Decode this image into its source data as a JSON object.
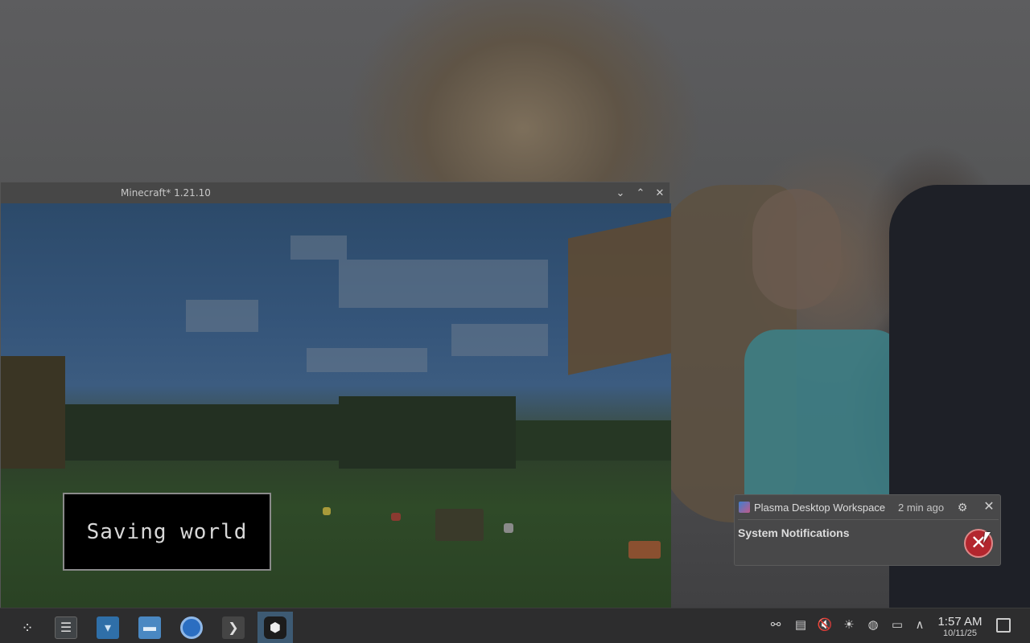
{
  "window": {
    "title": "Minecraft* 1.21.10",
    "minimize_glyph": "⌄",
    "maximize_glyph": "⌃",
    "close_glyph": "✕"
  },
  "game": {
    "overlay_text": "Saving world"
  },
  "notification": {
    "app_name": "Plasma Desktop Workspace",
    "time_ago": "2 min ago",
    "title": "System Notifications",
    "config_glyph": "⚙",
    "close_glyph": "✕",
    "error_glyph": "✕",
    "error_color": "#b3262e"
  },
  "taskbar": {
    "launcher_glyph": "⁘",
    "apps": [
      {
        "name": "system-settings",
        "icon": "sliders-icon",
        "glyph": "☰"
      },
      {
        "name": "discover",
        "icon": "shopping-bag-icon",
        "glyph": "▾"
      },
      {
        "name": "file-manager",
        "icon": "folder-icon",
        "glyph": "▬"
      },
      {
        "name": "web-browser",
        "icon": "globe-icon",
        "glyph": ""
      },
      {
        "name": "terminal",
        "icon": "terminal-icon",
        "glyph": "❯"
      },
      {
        "name": "minecraft",
        "icon": "cube-icon",
        "glyph": "⬢",
        "active": true
      }
    ],
    "tray": {
      "kdeconnect_glyph": "⚯",
      "clipboard_glyph": "▤",
      "volume_glyph": "🔇",
      "brightness_glyph": "☀",
      "network_glyph": "◍",
      "display_glyph": "▭",
      "expand_glyph": "∧"
    },
    "clock": {
      "time": "1:57 AM",
      "date": "10/11/25"
    },
    "accent_color": "#3d5a73"
  }
}
